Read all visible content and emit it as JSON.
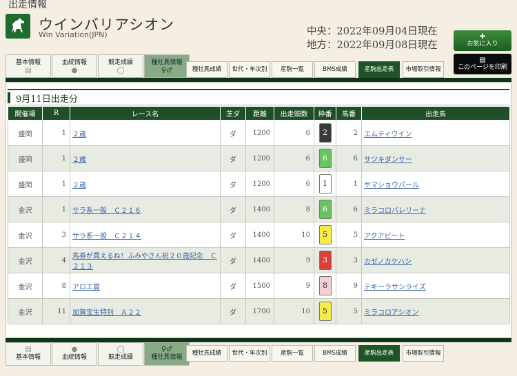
{
  "breadcrumb": "出走情報",
  "horse": {
    "name": "ウインバリアシオン",
    "name_en": "Win Variation(JPN)"
  },
  "update_dates": [
    "中央：2022年09月04日現在",
    "地方：2022年09月08日現在"
  ],
  "buttons": {
    "favorite": "お気に入り",
    "print": "このページを印刷"
  },
  "main_tabs": [
    {
      "label": "基本情報",
      "icon": "document-icon"
    },
    {
      "label": "血統情報",
      "icon": "drop-icon"
    },
    {
      "label": "競走成績",
      "icon": "horseshoe-icon"
    },
    {
      "label": "種牡馬情報",
      "icon": "gender-icon"
    }
  ],
  "sub_tabs": [
    "種牡馬成績",
    "世代・年次別",
    "産駒一覧",
    "BMS成績",
    "産駒出走表",
    "市場取引情報"
  ],
  "section_title": "9月11日出走分",
  "table": {
    "headers": [
      "開催場",
      "R",
      "レース名",
      "芝ダ",
      "距離",
      "出走頭数",
      "枠番",
      "馬番",
      "出走馬"
    ],
    "rows": [
      {
        "venue": "盛岡",
        "r": "1",
        "race": "２歳",
        "surface": "ダ",
        "distance": "1200",
        "runners": "6",
        "waku": "2",
        "umaban": "2",
        "horse": "エムティウイン"
      },
      {
        "venue": "盛岡",
        "r": "1",
        "race": "２歳",
        "surface": "ダ",
        "distance": "1200",
        "runners": "6",
        "waku": "6",
        "umaban": "6",
        "horse": "サツキダンサー"
      },
      {
        "venue": "盛岡",
        "r": "1",
        "race": "２歳",
        "surface": "ダ",
        "distance": "1200",
        "runners": "6",
        "waku": "1",
        "umaban": "1",
        "horse": "ヤマショウパール"
      },
      {
        "venue": "金沢",
        "r": "1",
        "race": "サラ系一般　Ｃ２１６",
        "surface": "ダ",
        "distance": "1400",
        "runners": "8",
        "waku": "6",
        "umaban": "6",
        "horse": "ミラコロバレリーナ"
      },
      {
        "venue": "金沢",
        "r": "3",
        "race": "サラ系一般　Ｃ２１４",
        "surface": "ダ",
        "distance": "1400",
        "runners": "10",
        "waku": "5",
        "umaban": "5",
        "horse": "アクアビート"
      },
      {
        "venue": "金沢",
        "r": "4",
        "race": "馬券が買えるね！ふみやさん祝２０歳記念　Ｃ２１３",
        "surface": "ダ",
        "distance": "1400",
        "runners": "9",
        "waku": "3",
        "umaban": "3",
        "horse": "カゼノカケハシ"
      },
      {
        "venue": "金沢",
        "r": "8",
        "race": "アロエ賞",
        "surface": "ダ",
        "distance": "1500",
        "runners": "9",
        "waku": "8",
        "umaban": "9",
        "horse": "テキーラサンライズ"
      },
      {
        "venue": "金沢",
        "r": "11",
        "race": "加賀宝生特別　Ａ２２",
        "surface": "ダ",
        "distance": "1700",
        "runners": "10",
        "waku": "5",
        "umaban": "5",
        "horse": "ミラコロアシオン"
      }
    ]
  },
  "waku_colors": {
    "1": {
      "bg": "#ffffff",
      "fg": "#333333"
    },
    "2": {
      "bg": "#3a3a3a",
      "fg": "#ffffff"
    },
    "3": {
      "bg": "#d8403a",
      "fg": "#ffffff"
    },
    "5": {
      "bg": "#f5ec4a",
      "fg": "#333333"
    },
    "6": {
      "bg": "#6cc160",
      "fg": "#ffffff"
    },
    "8": {
      "bg": "#f6cfd3",
      "fg": "#333333"
    }
  },
  "colors": {
    "accent": "#1f5526",
    "link": "#3561a8"
  }
}
